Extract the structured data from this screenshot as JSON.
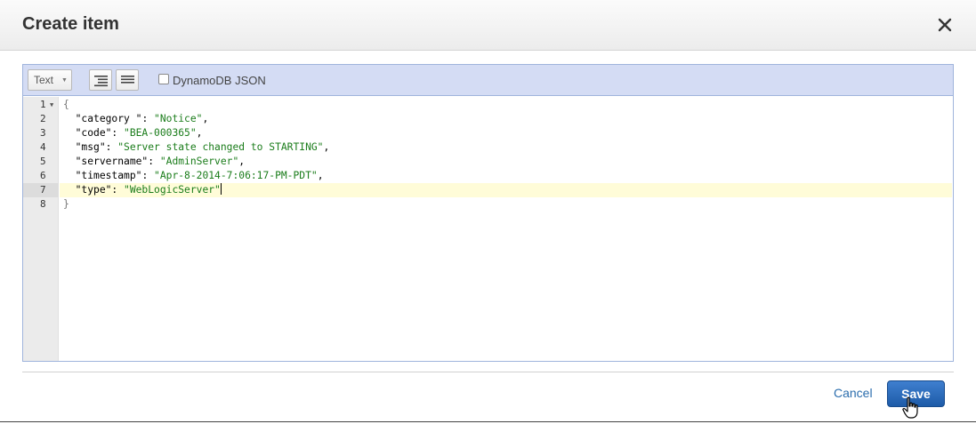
{
  "dialog": {
    "title": "Create item",
    "close_icon": "close-icon"
  },
  "toolbar": {
    "mode_value": "Text",
    "format_icon": "format-code-icon",
    "compact_icon": "compact-code-icon",
    "dynamodb_json_label": "DynamoDB JSON",
    "dynamodb_json_checked": false
  },
  "editor": {
    "active_line": 7,
    "lines": [
      {
        "num": "1",
        "key": "",
        "value": "",
        "text": "{"
      },
      {
        "num": "2",
        "key": "\"category \"",
        "value": "\"Notice\"",
        "sep": ",",
        "text": ""
      },
      {
        "num": "3",
        "key": "\"code\"",
        "value": "\"BEA-000365\"",
        "sep": ",",
        "text": ""
      },
      {
        "num": "4",
        "key": "\"msg\"",
        "value": "\"Server state changed to STARTING\"",
        "sep": ",",
        "text": ""
      },
      {
        "num": "5",
        "key": "\"servername\"",
        "value": "\"AdminServer\"",
        "sep": ",",
        "text": ""
      },
      {
        "num": "6",
        "key": "\"timestamp\"",
        "value": "\"Apr-8-2014-7:06:17-PM-PDT\"",
        "sep": ",",
        "text": ""
      },
      {
        "num": "7",
        "key": "\"type\"",
        "value": "\"WebLogicServer\"",
        "sep": "",
        "text": ""
      },
      {
        "num": "8",
        "key": "",
        "value": "",
        "text": "}"
      }
    ]
  },
  "footer": {
    "cancel_label": "Cancel",
    "save_label": "Save"
  },
  "colors": {
    "accent": "#1d5ba8",
    "string": "#1a7c1a",
    "active_line_bg": "#fffcd8",
    "toolbar_bg": "#d4dcf4"
  }
}
